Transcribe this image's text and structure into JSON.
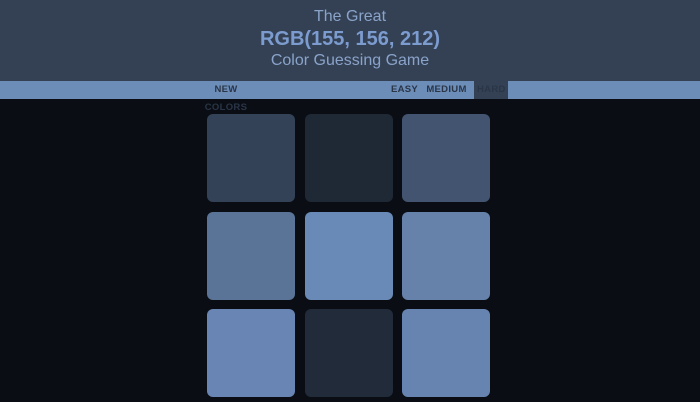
{
  "header": {
    "line1": "The Great",
    "rgb_display": "RGB(155, 156, 212)",
    "line3": "Color Guessing Game"
  },
  "toolbar": {
    "new_colors_label": "NEW COLORS",
    "easy_label": "EASY",
    "medium_label": "MEDIUM",
    "hard_label": "HARD",
    "selected_mode": "HARD"
  },
  "colors": {
    "background": "#0a0e14",
    "header_bg": "#344155",
    "stripe_bg": "#6c8db8",
    "rgb_text": "#7c9ccf"
  },
  "squares": [
    {
      "color": "#344257"
    },
    {
      "color": "#1f2835"
    },
    {
      "color": "#435470"
    },
    {
      "color": "#5a7497"
    },
    {
      "color": "#6989b6"
    },
    {
      "color": "#6681aa"
    },
    {
      "color": "#6985b3"
    },
    {
      "color": "#212b3a"
    },
    {
      "color": "#6783b0"
    }
  ]
}
